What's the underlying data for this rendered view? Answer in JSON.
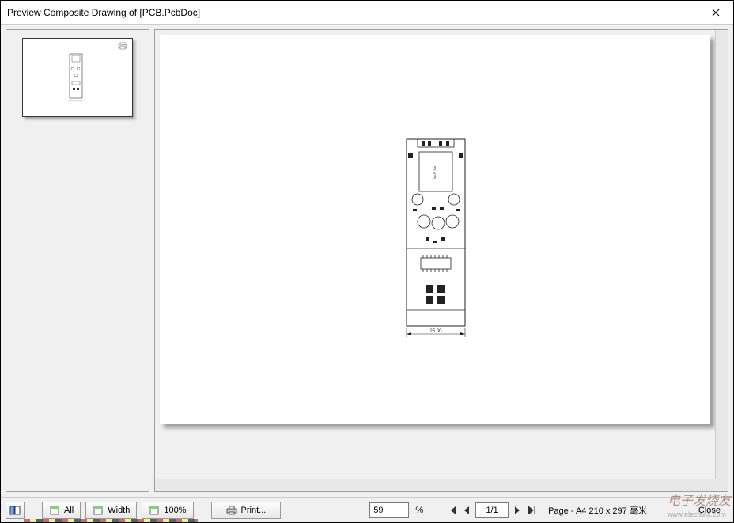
{
  "window": {
    "title": "Preview Composite Drawing of [PCB.PcbDoc]"
  },
  "toolbar": {
    "all_label": "All",
    "width_label": "Width",
    "hundred_label": "100%",
    "print_label": "Print...",
    "zoom_value": "59",
    "zoom_unit": "%",
    "page_value": "1/1",
    "page_info": "Page - A4 210 x 297 毫米",
    "close_label": "Close"
  },
  "pcb": {
    "dimension_label": "25.00"
  },
  "watermark": {
    "main": "电子发烧友",
    "sub": "www.elecfans.com"
  }
}
